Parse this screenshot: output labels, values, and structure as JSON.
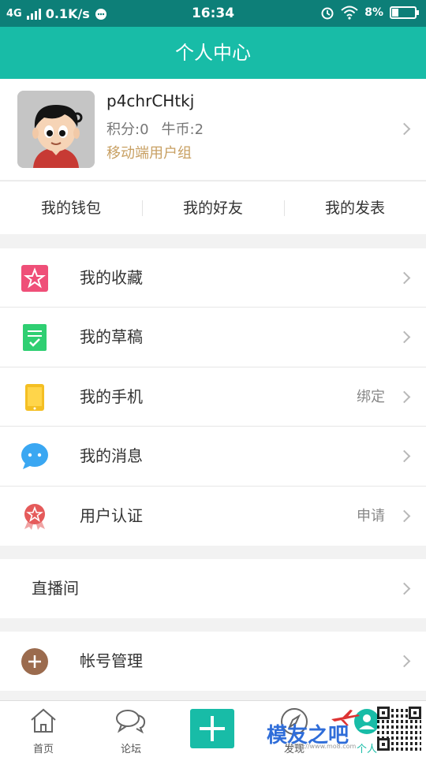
{
  "status_bar": {
    "network": "4G",
    "speed": "0.1K/s",
    "time": "16:34",
    "battery": "8%"
  },
  "header": {
    "title": "个人中心"
  },
  "profile": {
    "username": "p4chrCHtkj",
    "points": "积分:0",
    "coins": "牛币:2",
    "group": "移动端用户组"
  },
  "quick_links": [
    {
      "label": "我的钱包"
    },
    {
      "label": "我的好友"
    },
    {
      "label": "我的发表"
    }
  ],
  "menu": {
    "favorites": {
      "label": "我的收藏",
      "icon": "star-icon",
      "color": "#ef4f78"
    },
    "drafts": {
      "label": "我的草稿",
      "icon": "draft-check-icon",
      "color": "#2fcf72"
    },
    "phone": {
      "label": "我的手机",
      "extra": "绑定",
      "icon": "phone-icon",
      "color": "#f4bf23"
    },
    "messages": {
      "label": "我的消息",
      "icon": "chat-bubble-icon",
      "color": "#3aa7f2"
    },
    "verify": {
      "label": "用户认证",
      "extra": "申请",
      "icon": "badge-icon",
      "color": "#e55a5a"
    },
    "live": {
      "label": "直播间"
    },
    "account": {
      "label": "帐号管理",
      "icon": "plus-circle-icon",
      "color": "#9b6b4e"
    }
  },
  "bottom_nav": {
    "home": "首页",
    "forum": "论坛",
    "discover": "发现",
    "me": "个人"
  },
  "watermark": {
    "text": "模友之吧",
    "url": "http://www.mo8.com"
  }
}
